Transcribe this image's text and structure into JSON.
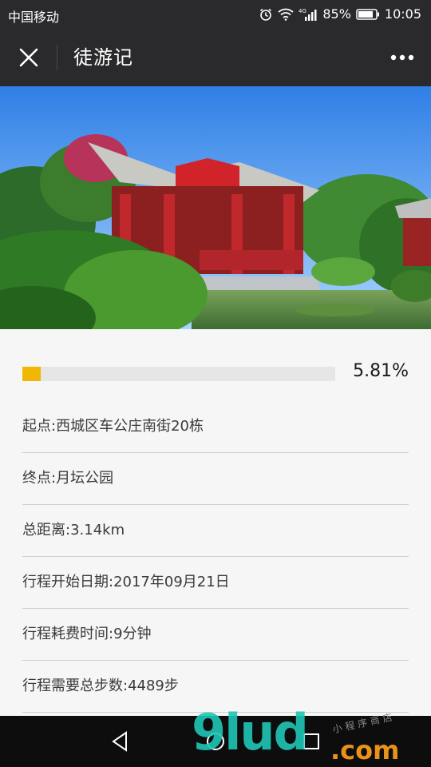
{
  "status_bar": {
    "carrier": "中国移动",
    "network": "4G",
    "battery": "85%",
    "time": "10:05",
    "icons": [
      "alarm-icon",
      "wifi-icon",
      "signal-icon",
      "battery-icon"
    ]
  },
  "nav": {
    "title": "徒游记",
    "close_icon": "close-icon",
    "more_icon": "more-icon"
  },
  "hero": {
    "description_icon": "garden-photo"
  },
  "progress": {
    "value_percent": 5.81,
    "label": "5.81%",
    "color": "#f2b705"
  },
  "info": [
    {
      "label": "起点:西城区车公庄南街20栋"
    },
    {
      "label": "终点:月坛公园"
    },
    {
      "label": "总距离:3.14km"
    },
    {
      "label": "行程开始日期:2017年09月21日"
    },
    {
      "label": "行程耗费时间:9分钟"
    },
    {
      "label": "行程需要总步数:4489步"
    }
  ],
  "bottom_nav": {
    "icons": [
      "back-triangle-icon",
      "home-circle-icon",
      "recent-square-icon"
    ]
  },
  "watermark": {
    "main": "9lud",
    "suffix": ".com",
    "tagline": "小程序商店"
  }
}
